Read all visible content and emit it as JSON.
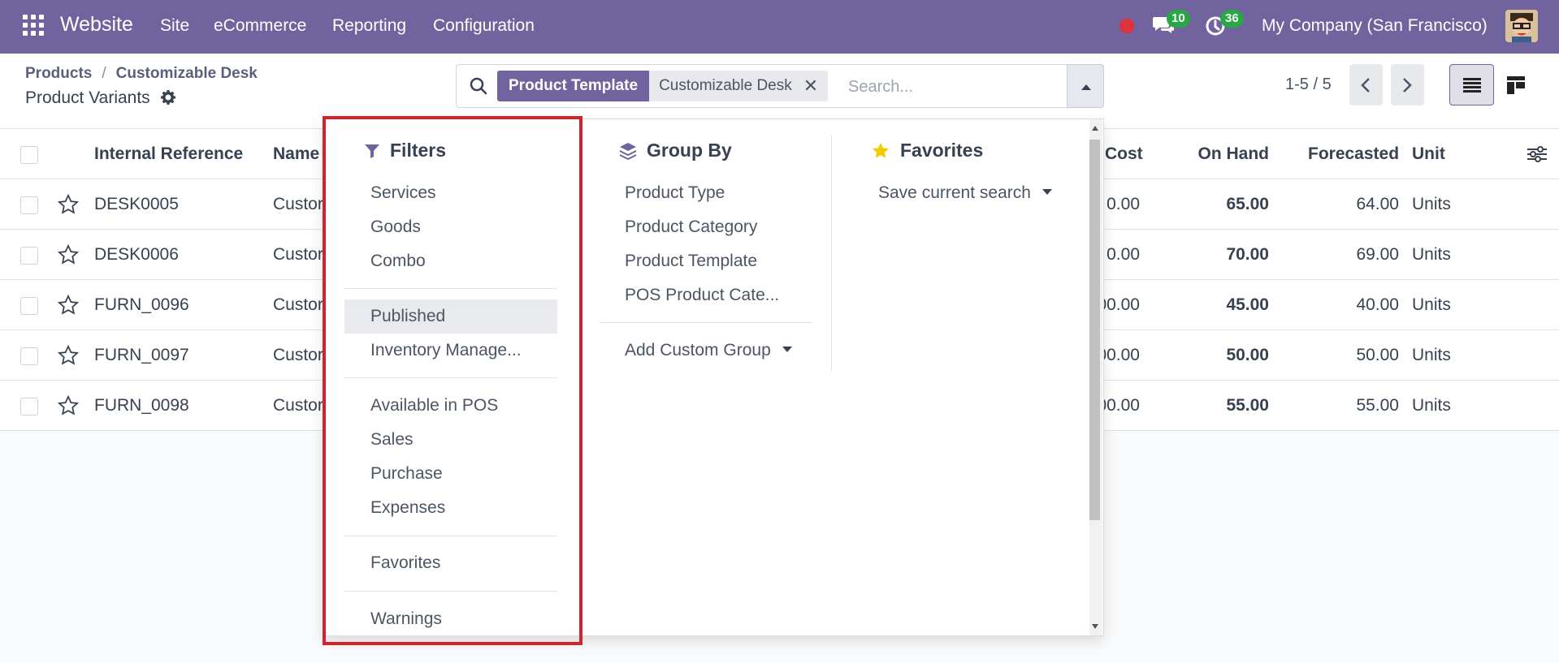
{
  "navbar": {
    "app_name": "Website",
    "menu": [
      "Site",
      "eCommerce",
      "Reporting",
      "Configuration"
    ],
    "messages_count": "10",
    "activities_count": "36",
    "company": "My Company (San Francisco)"
  },
  "breadcrumb": {
    "items": [
      "Products",
      "Customizable Desk"
    ],
    "separator": "/",
    "current": "Product Variants"
  },
  "search": {
    "facet_label": "Product Template",
    "facet_value": "Customizable Desk",
    "placeholder": "Search..."
  },
  "pager": {
    "text": "1-5 / 5"
  },
  "table": {
    "columns": {
      "internal_reference": "Internal Reference",
      "name": "Name",
      "cost": "Cost",
      "on_hand": "On Hand",
      "forecasted": "Forecasted",
      "unit": "Unit"
    },
    "rows": [
      {
        "ref": "DESK0005",
        "name": "Custor",
        "cost": "0.00",
        "on_hand": "65.00",
        "forecasted": "64.00",
        "unit": "Units"
      },
      {
        "ref": "DESK0006",
        "name": "Custor",
        "cost": "0.00",
        "on_hand": "70.00",
        "forecasted": "69.00",
        "unit": "Units"
      },
      {
        "ref": "FURN_0096",
        "name": "Custor",
        "cost": "00.00",
        "on_hand": "45.00",
        "forecasted": "40.00",
        "unit": "Units"
      },
      {
        "ref": "FURN_0097",
        "name": "Custor",
        "cost": "00.00",
        "on_hand": "50.00",
        "forecasted": "50.00",
        "unit": "Units"
      },
      {
        "ref": "FURN_0098",
        "name": "Custor",
        "cost": "00.00",
        "on_hand": "55.00",
        "forecasted": "55.00",
        "unit": "Units"
      }
    ]
  },
  "dropdown": {
    "filters": {
      "title": "Filters",
      "items": [
        "Services",
        "Goods",
        "Combo",
        "Published",
        "Inventory Manage...",
        "Available in POS",
        "Sales",
        "Purchase",
        "Expenses",
        "Favorites",
        "Warnings"
      ]
    },
    "group_by": {
      "title": "Group By",
      "items": [
        "Product Type",
        "Product Category",
        "Product Template",
        "POS Product Cate..."
      ],
      "custom": "Add Custom Group"
    },
    "favorites": {
      "title": "Favorites",
      "save": "Save current search"
    }
  },
  "colors": {
    "brand": "#71639e",
    "badge": "#28a745",
    "highlight": "#d3222a",
    "star": "#f3cc00"
  }
}
